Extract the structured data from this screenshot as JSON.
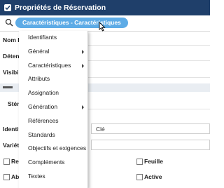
{
  "window": {
    "title": "Propriétés de Réservation"
  },
  "toolbar": {
    "breadcrumb": "Caractéristiques - Caractéristiques"
  },
  "form": {
    "labels": [
      "Nom L",
      "Détent",
      "Visibi",
      "Stén",
      "Identif",
      "Variétié"
    ],
    "identifier_value": "Clé"
  },
  "checkboxes": [
    {
      "label": "Re",
      "checked": false
    },
    {
      "label": "Ab",
      "checked": false
    },
    {
      "label": "Feuille",
      "checked": false
    },
    {
      "label": "Active",
      "checked": false
    }
  ],
  "menu": {
    "items": [
      {
        "label": "Identifiants",
        "submenu": false
      },
      {
        "label": "Général",
        "submenu": true
      },
      {
        "label": "Caractéristiques",
        "submenu": true
      },
      {
        "label": "Attributs",
        "submenu": false
      },
      {
        "label": "Assignation",
        "submenu": false
      },
      {
        "label": "Génération",
        "submenu": true
      },
      {
        "label": "Références",
        "submenu": false
      },
      {
        "label": "Standards",
        "submenu": false
      },
      {
        "label": "Objectifs et exigences",
        "submenu": false
      },
      {
        "label": "Compléments",
        "submenu": false
      },
      {
        "label": "Textes",
        "submenu": false
      }
    ]
  },
  "colors": {
    "titlebar": "#1f3f6a",
    "accent": "#5dabe6"
  }
}
